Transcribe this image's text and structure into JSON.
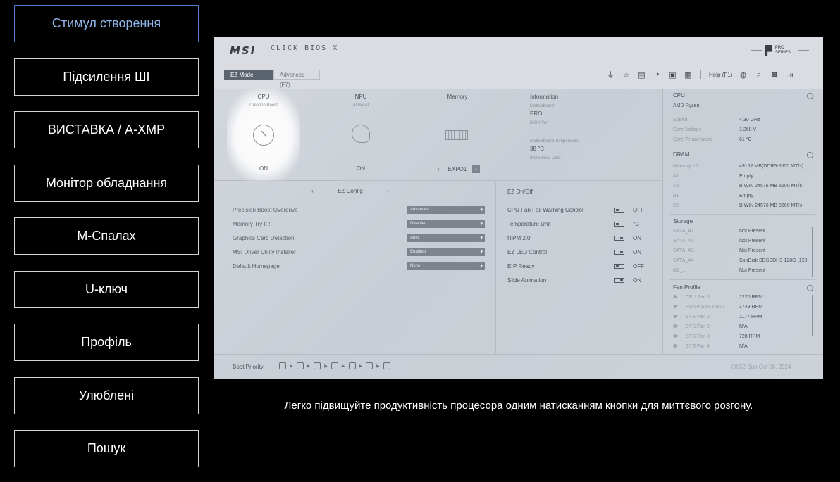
{
  "menu": {
    "items": [
      {
        "label": "Стимул створення",
        "active": true
      },
      {
        "label": "Підсилення ШІ"
      },
      {
        "label": "ВИСТАВКА / A-XMP"
      },
      {
        "label": "Монітор обладнання"
      },
      {
        "label": "M-Спалах"
      },
      {
        "label": "U-ключ"
      },
      {
        "label": "Профіль"
      },
      {
        "label": "Улюблені"
      },
      {
        "label": "Пошук"
      }
    ]
  },
  "bios": {
    "logo": "MSI",
    "title": "CLICK BIOS X",
    "series_badge": "PRO SERIES",
    "mode_tabs": {
      "ez": "EZ Mode",
      "advanced": "Advanced (F7)"
    },
    "help_label": "Help (F1)",
    "cards": {
      "cpu": {
        "caption": "CPU",
        "sub": "Creation Boost",
        "value": "ON"
      },
      "npu": {
        "caption": "NPU",
        "sub": "AI Boost",
        "value": "ON"
      },
      "memory": {
        "caption": "Memory",
        "value": "EXPO1"
      }
    },
    "information": {
      "heading": "Information",
      "mb_label": "Motherboard",
      "mb_value": "PRO",
      "bios_ver_label": "BIOS Ver",
      "temp_label": "Motherboard Temperature",
      "temp_value": "38 °C",
      "build_label": "BIOS Build Date"
    },
    "ez_config": {
      "title": "EZ Config",
      "rows": [
        {
          "label": "Precision Boost Overdrive",
          "value": "Advanced"
        },
        {
          "label": "Memory Try It !",
          "value": "Disabled"
        },
        {
          "label": "Graphics Card Detection",
          "value": "Auto"
        },
        {
          "label": "MSI Driver Utility Installer",
          "value": "Enabled"
        },
        {
          "label": "Default Homepage",
          "value": "None"
        }
      ]
    },
    "ez_onoff": {
      "title": "EZ On/Off",
      "rows": [
        {
          "label": "CPU Fan Fail Warning Control",
          "state": "OFF",
          "on": false
        },
        {
          "label": "Temperature Unit",
          "state": "°C",
          "on": false
        },
        {
          "label": "fTPM 2.0",
          "state": "ON",
          "on": true
        },
        {
          "label": "EZ LED Control",
          "state": "ON",
          "on": true
        },
        {
          "label": "ErP Ready",
          "state": "OFF",
          "on": false
        },
        {
          "label": "Slide Animation",
          "state": "ON",
          "on": true
        }
      ]
    },
    "panel": {
      "cpu": {
        "title": "CPU",
        "name": "AMD Ryzen",
        "rows": [
          {
            "k": "Speed",
            "v": "4.30 GHz"
          },
          {
            "k": "Core Voltage",
            "v": "1.368 V"
          },
          {
            "k": "Core Temperature",
            "v": "61 °C"
          }
        ]
      },
      "dram": {
        "title": "DRAM",
        "rows": [
          {
            "k": "Memory Info",
            "v": "49152 MB(DDR5-5600 MT/s)"
          },
          {
            "k": "A1",
            "v": "Empty"
          },
          {
            "k": "A2",
            "v": "BIWIN 24576 MB 5600 MT/s"
          },
          {
            "k": "B1",
            "v": "Empty"
          },
          {
            "k": "B2",
            "v": "BIWIN 24576 MB 5600 MT/s"
          }
        ]
      },
      "storage": {
        "title": "Storage",
        "rows": [
          {
            "k": "SATA_A1",
            "v": "Not Present"
          },
          {
            "k": "SATA_A2",
            "v": "Not Present"
          },
          {
            "k": "SATA_A3",
            "v": "Not Present"
          },
          {
            "k": "SATA_A4",
            "v": "SanDisk SDSSDH3-128G (128"
          },
          {
            "k": "M2_1",
            "v": "Not Present"
          }
        ]
      },
      "fans": {
        "title": "Fan Profile",
        "rows": [
          {
            "k": "CPU Fan 1",
            "v": "1220 RPM"
          },
          {
            "k": "PUMP SYS Fan 1",
            "v": "1749 RPM"
          },
          {
            "k": "SYS Fan 1",
            "v": "1177 RPM"
          },
          {
            "k": "SYS Fan 2",
            "v": "N/A"
          },
          {
            "k": "SYS Fan 3",
            "v": "728 RPM"
          },
          {
            "k": "SYS Fan 4",
            "v": "N/A"
          }
        ]
      }
    },
    "footer": {
      "boot_label": "Boot Priority",
      "clock": "08:52  Sun Oct 06, 2024"
    }
  },
  "caption": "Легко підвищуйте продуктивність процесора одним натисканням кнопки для миттєвого розгону."
}
